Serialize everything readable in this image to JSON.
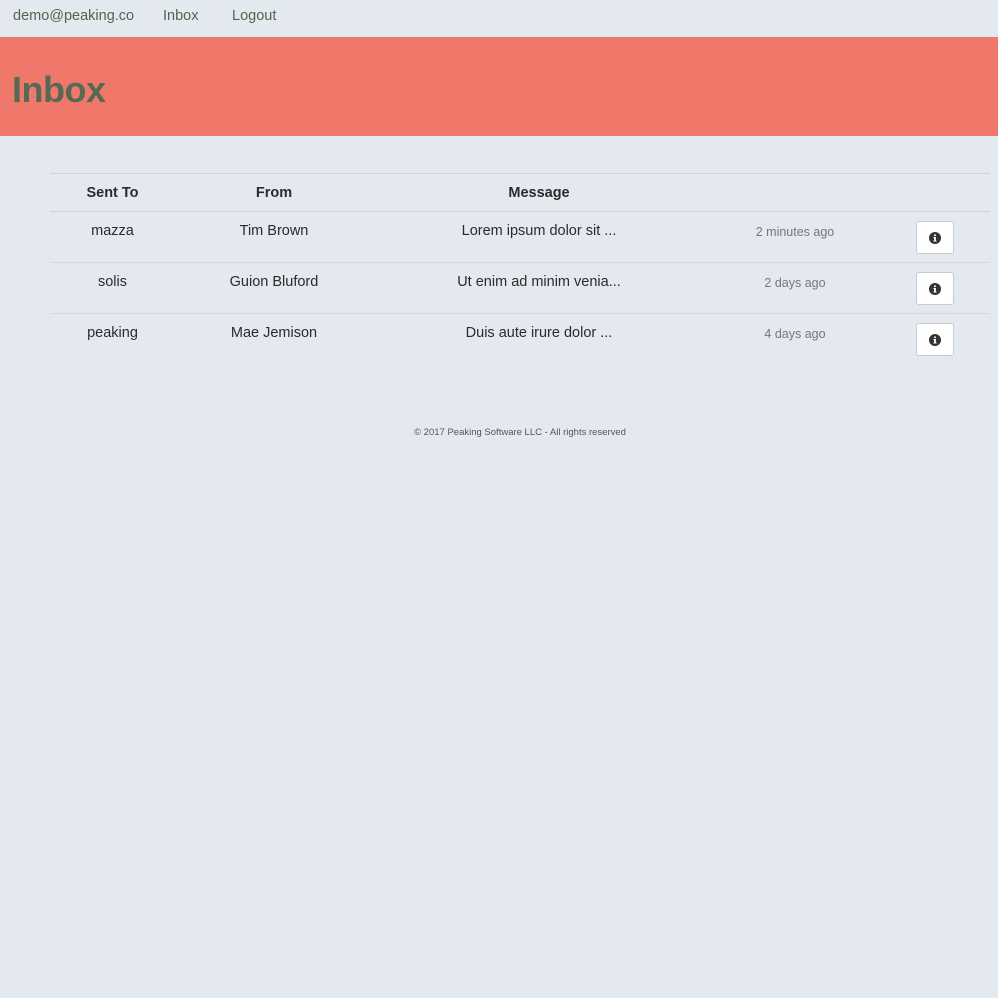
{
  "nav": {
    "user": "demo@peaking.co",
    "inbox": "Inbox",
    "logout": "Logout"
  },
  "page_title": "Inbox",
  "table": {
    "headers": {
      "sent_to": "Sent To",
      "from": "From",
      "message": "Message"
    },
    "rows": [
      {
        "sent_to": "mazza",
        "from": "Tim Brown",
        "message": "Lorem ipsum dolor sit ...",
        "time": "2 minutes ago",
        "action_icon": "info-circle-icon"
      },
      {
        "sent_to": "solis",
        "from": "Guion Bluford",
        "message": "Ut enim ad minim venia...",
        "time": "2 days ago",
        "action_icon": "info-circle-icon"
      },
      {
        "sent_to": "peaking",
        "from": "Mae Jemison",
        "message": "Duis aute irure dolor ...",
        "time": "4 days ago",
        "action_icon": "info-circle-icon"
      }
    ]
  },
  "footer": {
    "copyright": "© 2017 Peaking Software LLC - All rights reserved"
  },
  "colors": {
    "background": "#e4e8ef",
    "hero": "#f0786a",
    "title_text": "#546a55",
    "nav_link": "#4e6652"
  }
}
